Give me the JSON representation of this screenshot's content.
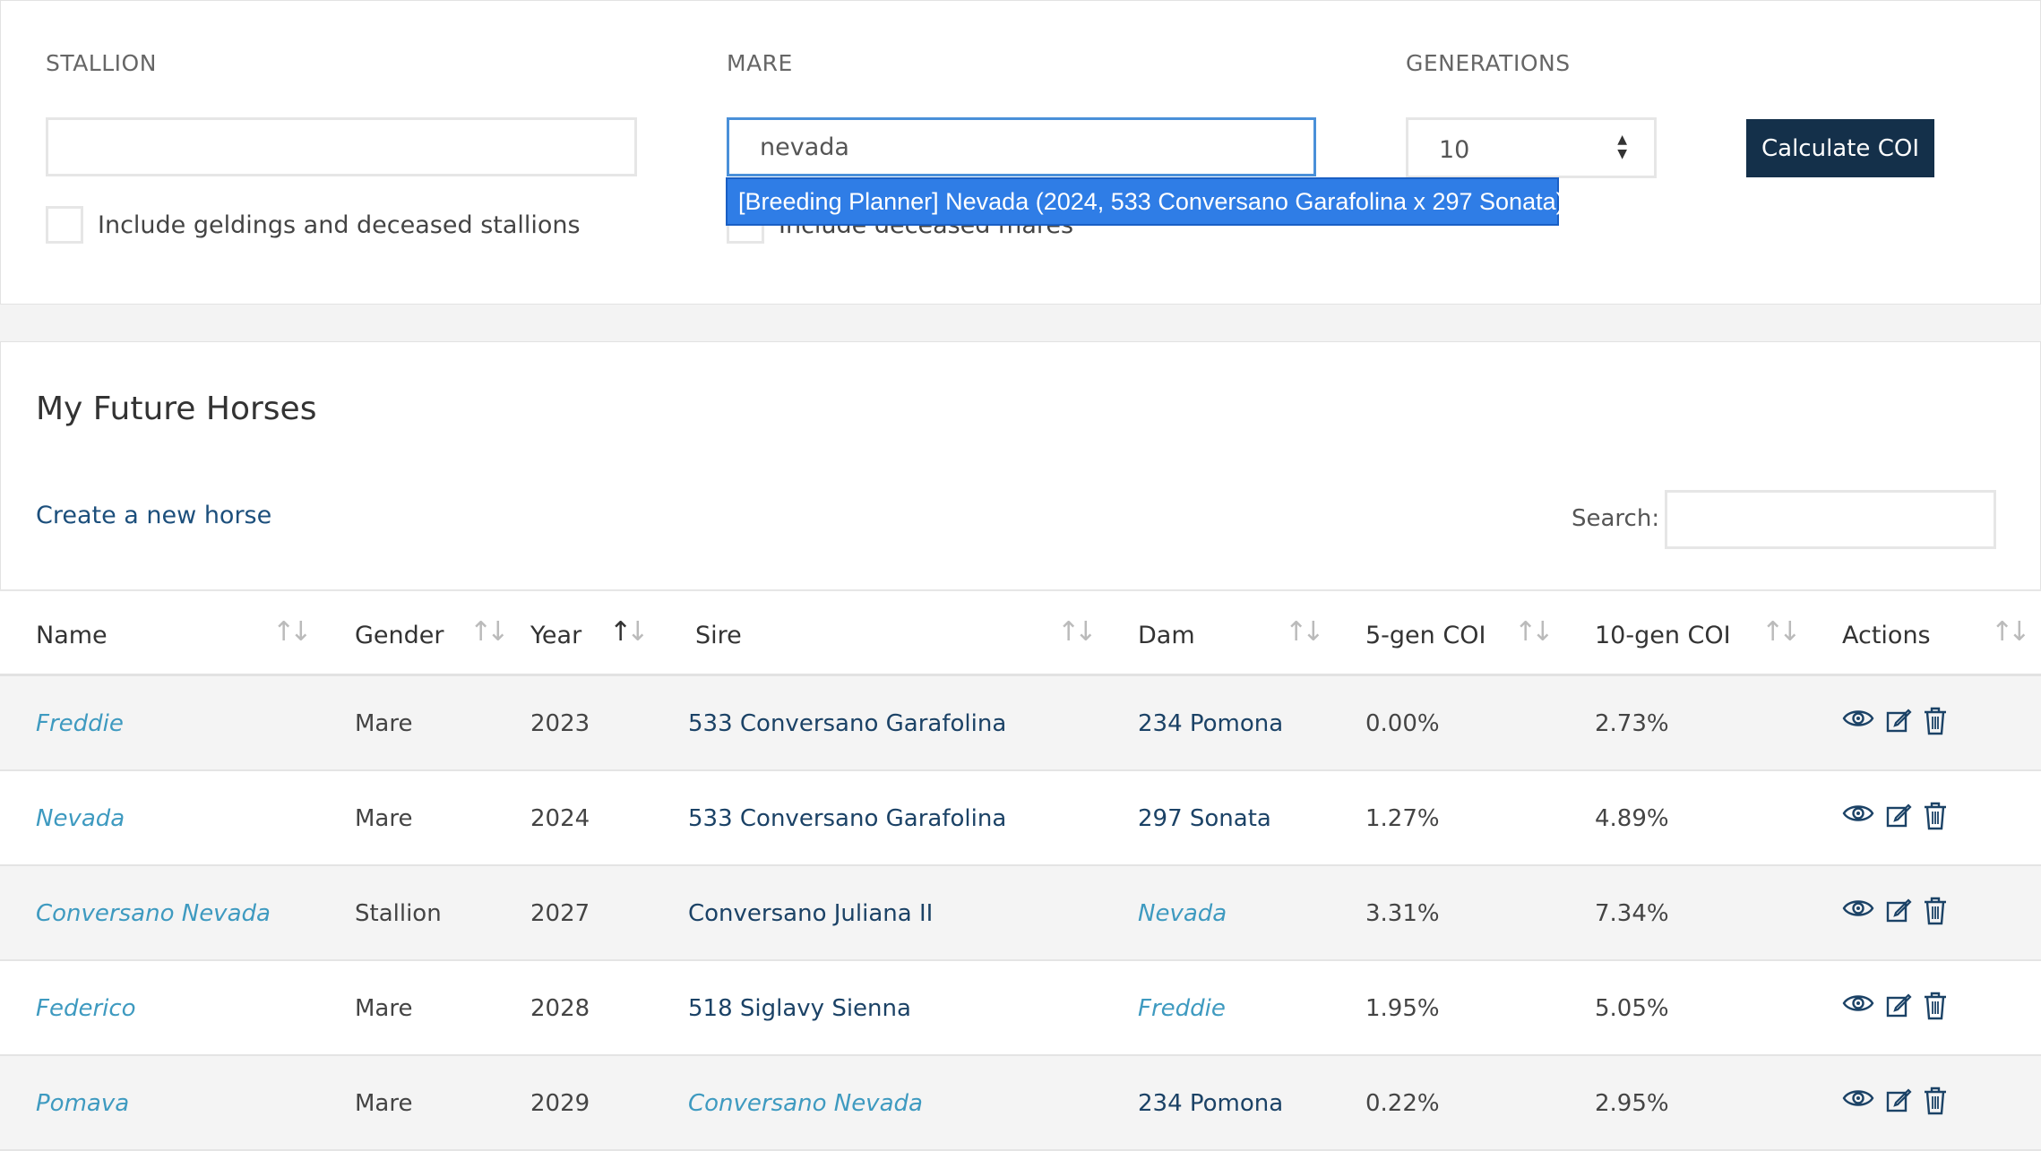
{
  "coi_form": {
    "stallion_label": "STALLION",
    "stallion_value": "",
    "stallion_checkbox_label": "Include geldings and deceased stallions",
    "mare_label": "MARE",
    "mare_value": "nevada",
    "mare_checkbox_label": "Include deceased mares",
    "generations_label": "GENERATIONS",
    "generations_value": "10",
    "calculate_label": "Calculate COI",
    "autocomplete_suggestion": "[Breeding Planner] Nevada (2024, 533 Conversano Garafolina x 297 Sonata)"
  },
  "future_horses": {
    "title": "My Future Horses",
    "create_link": "Create a new horse",
    "search_label": "Search:",
    "search_value": "",
    "columns": [
      "Name",
      "Gender",
      "Year",
      "Sire",
      "Dam",
      "5-gen COI",
      "10-gen COI",
      "Actions"
    ],
    "sorted_column": "Year",
    "rows": [
      {
        "name": "Freddie",
        "gender": "Mare",
        "year": "2023",
        "sire": "533 Conversano Garafolina",
        "sire_future": false,
        "dam": "234 Pomona",
        "dam_future": false,
        "coi5": "0.00%",
        "coi10": "2.73%"
      },
      {
        "name": "Nevada",
        "gender": "Mare",
        "year": "2024",
        "sire": "533 Conversano Garafolina",
        "sire_future": false,
        "dam": "297 Sonata",
        "dam_future": false,
        "coi5": "1.27%",
        "coi10": "4.89%"
      },
      {
        "name": "Conversano Nevada",
        "gender": "Stallion",
        "year": "2027",
        "sire": "Conversano Juliana II",
        "sire_future": false,
        "dam": "Nevada",
        "dam_future": true,
        "coi5": "3.31%",
        "coi10": "7.34%"
      },
      {
        "name": "Federico",
        "gender": "Mare",
        "year": "2028",
        "sire": "518 Siglavy Sienna",
        "sire_future": false,
        "dam": "Freddie",
        "dam_future": true,
        "coi5": "1.95%",
        "coi10": "5.05%"
      },
      {
        "name": "Pomava",
        "gender": "Mare",
        "year": "2029",
        "sire": "Conversano Nevada",
        "sire_future": true,
        "dam": "234 Pomona",
        "dam_future": false,
        "coi5": "0.22%",
        "coi10": "2.95%"
      }
    ],
    "row_action_icons": [
      "eye-icon",
      "edit-icon",
      "trash-icon"
    ]
  },
  "colors": {
    "primary_button": "#14304a",
    "future_link": "#3e9ac0",
    "real_link": "#1b4266",
    "autocomplete_highlight": "#2f7de6"
  }
}
